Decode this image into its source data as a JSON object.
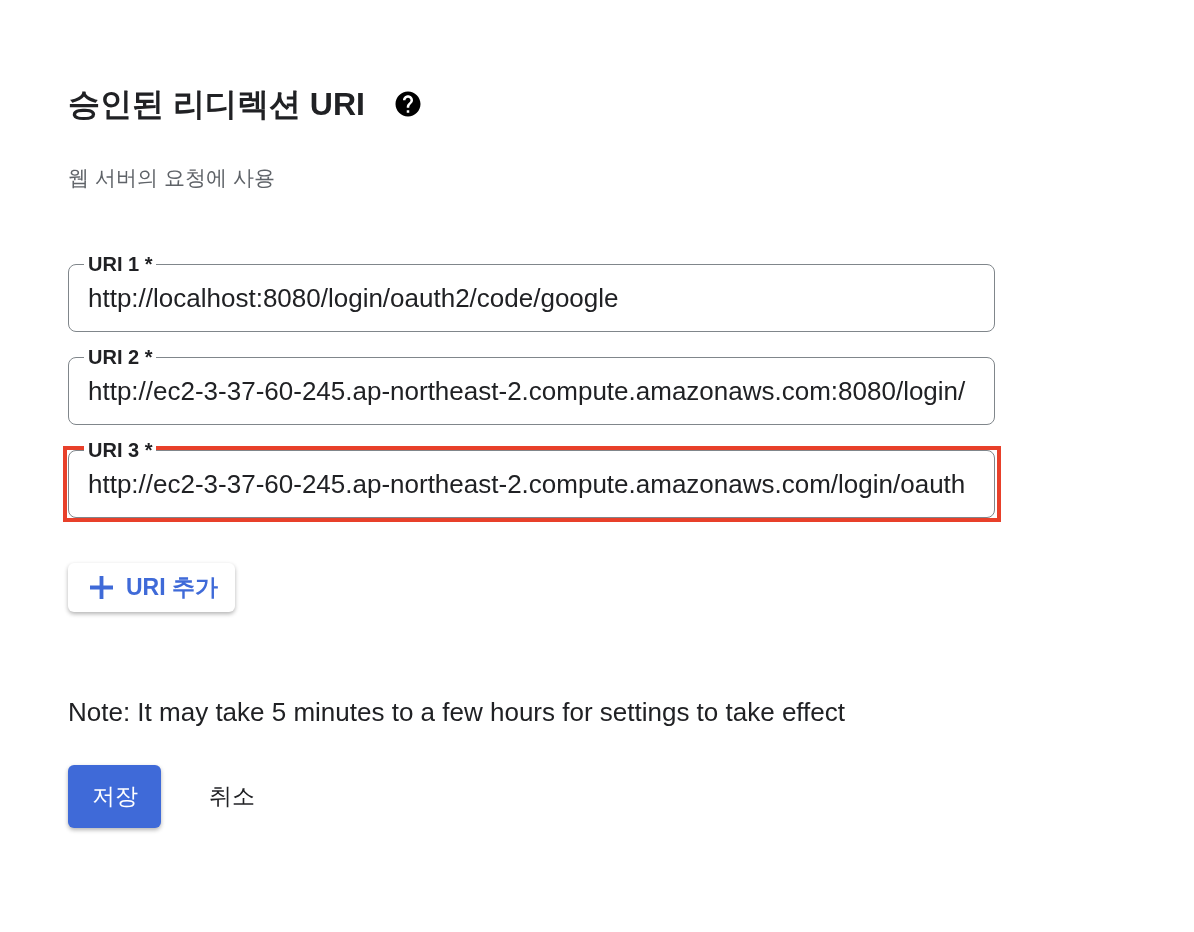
{
  "header": {
    "title": "승인된 리디렉션 URI",
    "subtitle": "웹 서버의 요청에 사용"
  },
  "uris": [
    {
      "label": "URI 1 *",
      "value": "http://localhost:8080/login/oauth2/code/google",
      "highlighted": false
    },
    {
      "label": "URI 2 *",
      "value": "http://ec2-3-37-60-245.ap-northeast-2.compute.amazonaws.com:8080/login/",
      "highlighted": false
    },
    {
      "label": "URI 3 *",
      "value": "http://ec2-3-37-60-245.ap-northeast-2.compute.amazonaws.com/login/oauth",
      "highlighted": true
    }
  ],
  "add_button": {
    "label": "URI 추가"
  },
  "note": "Note: It may take 5 minutes to a few hours for settings to take effect",
  "actions": [
    {
      "kind": "primary",
      "label": "저장"
    },
    {
      "kind": "text",
      "label": "취소"
    }
  ]
}
